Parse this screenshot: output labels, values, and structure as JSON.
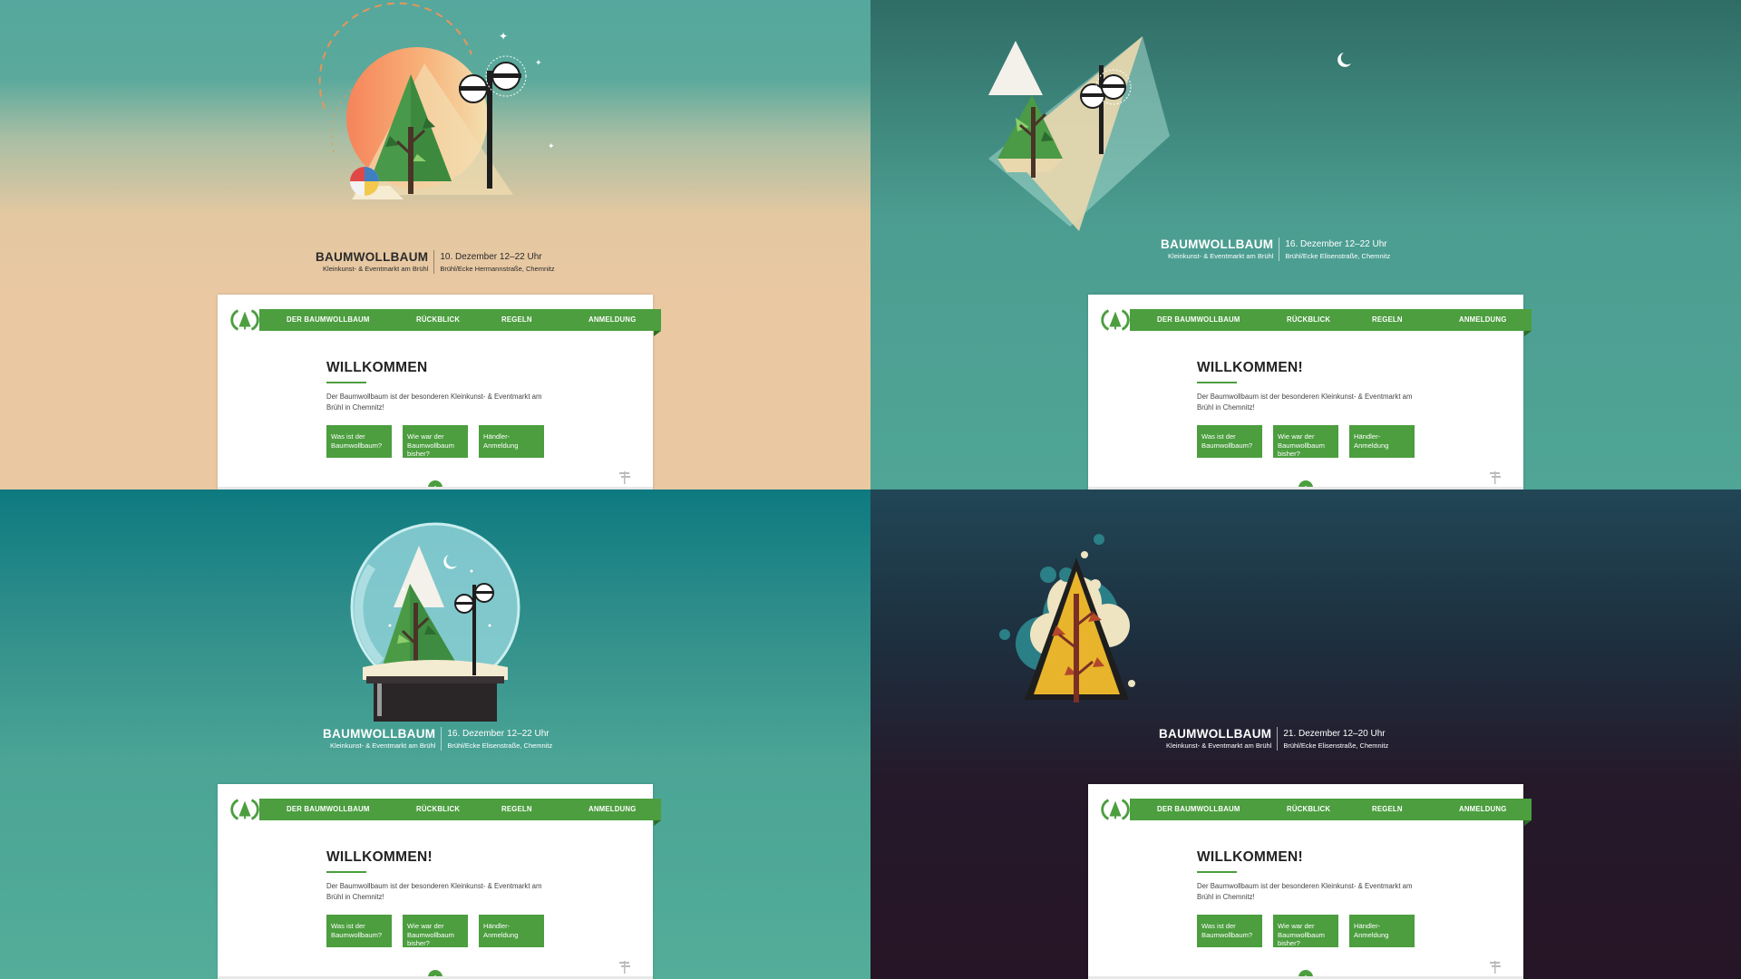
{
  "panels": [
    {
      "id": "summer",
      "brand": "BAUMWOLLBAUM",
      "subtitle": "Kleinkunst- & Eventmarkt am Brühl",
      "date": "10. Dezember 12–22 Uhr",
      "address": "Brühl/Ecke Hermannstraße, Chemnitz",
      "headline": "WILLKOMMEN",
      "intro": "Der Baumwollbaum ist der besonderen Kleinkunst- & Eventmarkt am Brühl in Chemnitz!",
      "background": "#e9c8a2"
    },
    {
      "id": "evening",
      "brand": "BAUMWOLLBAUM",
      "subtitle": "Kleinkunst- & Eventmarkt am Brühl",
      "date": "16. Dezember 12–22 Uhr",
      "address": "Brühl/Ecke Elisenstraße, Chemnitz",
      "headline": "WILLKOMMEN!",
      "intro": "Der Baumwollbaum ist der besonderen Kleinkunst- & Eventmarkt am Brühl in Chemnitz!",
      "background": "#4fa596"
    },
    {
      "id": "snowglobe",
      "brand": "BAUMWOLLBAUM",
      "subtitle": "Kleinkunst- & Eventmarkt am Brühl",
      "date": "16. Dezember 12–22 Uhr",
      "address": "Brühl/Ecke Elisenstraße, Chemnitz",
      "headline": "WILLKOMMEN!",
      "intro": "Der Baumwollbaum ist der besonderen Kleinkunst- & Eventmarkt am Brühl in Chemnitz!",
      "background": "#53ad99"
    },
    {
      "id": "night",
      "brand": "BAUMWOLLBAUM",
      "subtitle": "Kleinkunst- & Eventmarkt am Brühl",
      "date": "21. Dezember 12–20 Uhr",
      "address": "Brühl/Ecke Elisenstraße, Chemnitz",
      "headline": "WILLKOMMEN!",
      "intro": "Der Baumwollbaum ist der besonderen Kleinkunst- & Eventmarkt am Brühl in Chemnitz!",
      "background": "#261526"
    }
  ],
  "nav": {
    "items": [
      "DER BAUMWOLLBAUM",
      "RÜCKBLICK",
      "REGELN",
      "ANMELDUNG"
    ],
    "logo_icon": "tree-logo-icon"
  },
  "buttons": [
    "Was ist der Baumwollbaum?",
    "Wie war der Baumwollbaum bisher?",
    "Händler-Anmeldung"
  ],
  "colors": {
    "accent": "#4c9e3f",
    "card": "#ffffff"
  },
  "icons": [
    "tree-logo-icon",
    "chevron-up-icon",
    "signpost-icon"
  ]
}
